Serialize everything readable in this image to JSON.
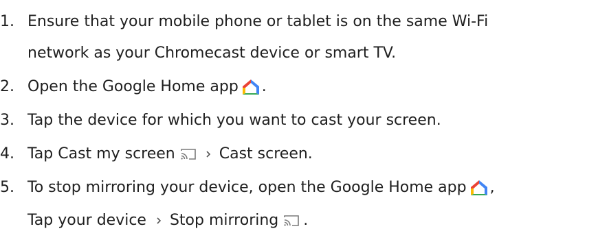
{
  "steps": [
    {
      "number": "1.",
      "line1": "Ensure that your mobile phone or tablet is on the same Wi-Fi",
      "line2": "network as your Chromecast device or smart TV."
    },
    {
      "number": "2.",
      "before": "Open the Google Home app",
      "after": "."
    },
    {
      "number": "3.",
      "text": "Tap the device for which you want to cast your screen."
    },
    {
      "number": "4.",
      "before": "Tap Cast my screen",
      "after": "Cast screen."
    },
    {
      "number": "5.",
      "line1_before": "To stop mirroring your device, open the Google Home app",
      "line1_after": ",",
      "line2_before": "Tap your device",
      "line2_middle": "Stop mirroring",
      "line2_after": "."
    }
  ],
  "icons": {
    "home": "google-home-icon",
    "cast": "cast-screen-icon",
    "chevron": "chevron-right-icon"
  },
  "colors": {
    "text": "#1f1f1f",
    "icon_gray": "#7a7a7a",
    "home_red": "#EA4335",
    "home_yellow": "#FBBC04",
    "home_green": "#34A853",
    "home_blue": "#4285F4"
  }
}
